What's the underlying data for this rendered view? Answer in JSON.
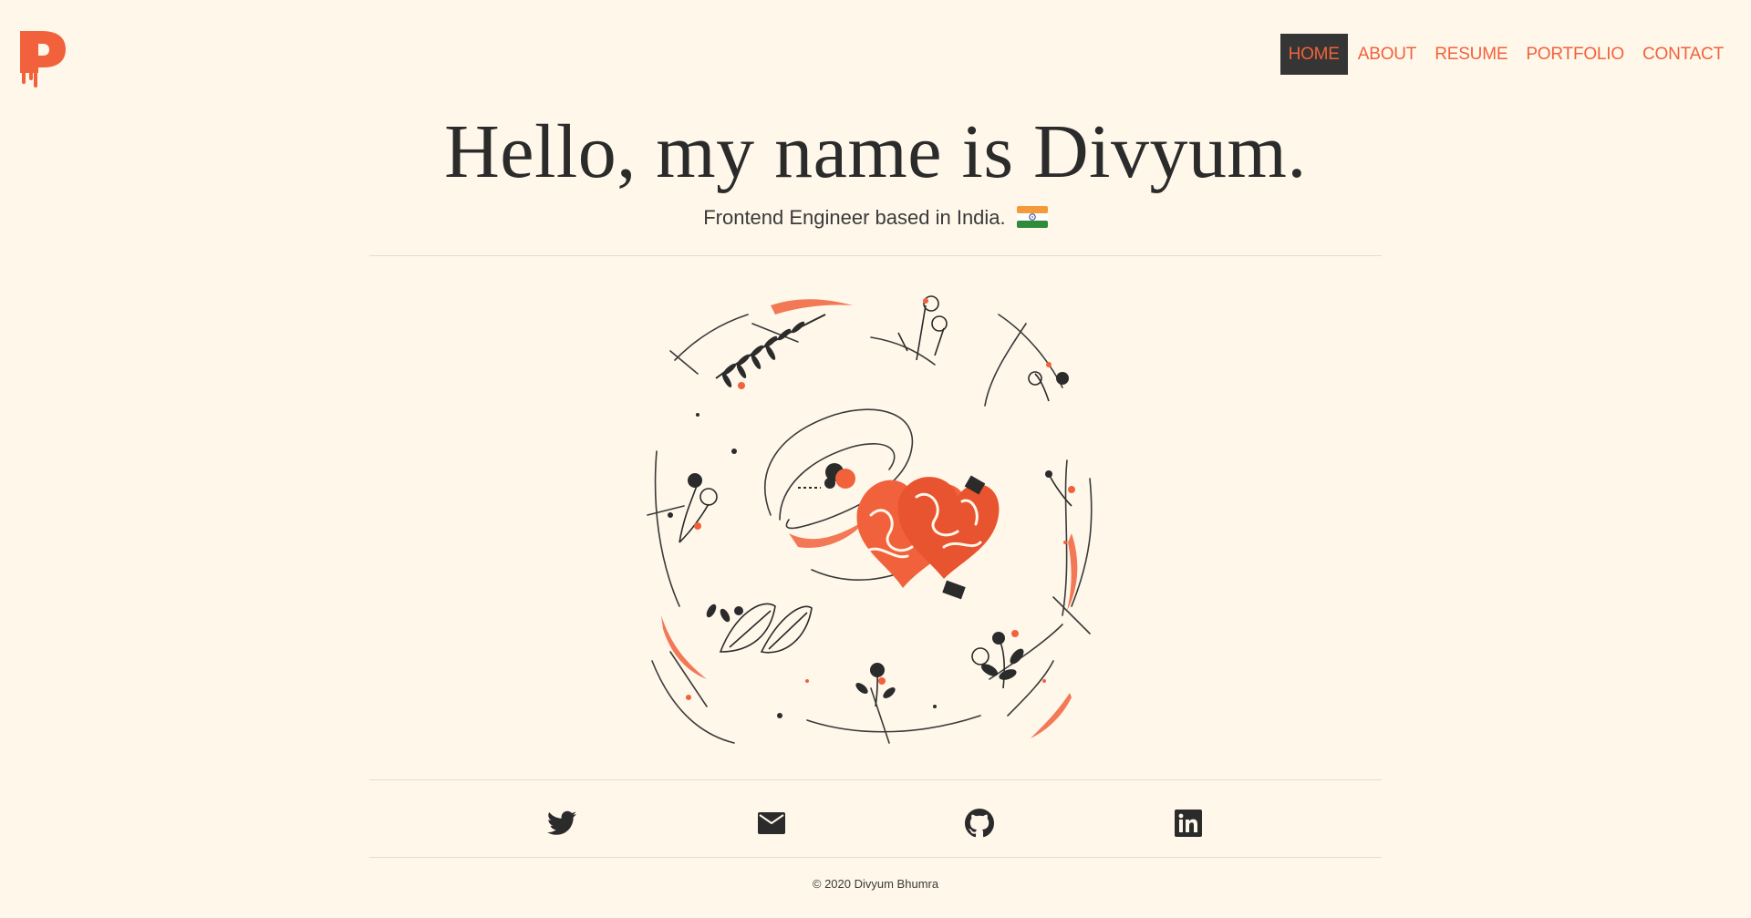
{
  "header": {
    "logo_icon": "drip-p-logo-icon",
    "brand_color": "#f1623c",
    "nav": [
      {
        "label": "HOME",
        "active": true
      },
      {
        "label": "ABOUT",
        "active": false
      },
      {
        "label": "RESUME",
        "active": false
      },
      {
        "label": "PORTFOLIO",
        "active": false
      },
      {
        "label": "CONTACT",
        "active": false
      }
    ]
  },
  "hero": {
    "title": "Hello, my name is Divyum.",
    "subtitle": "Frontend Engineer based in India.",
    "flag_icon": "india-flag-icon"
  },
  "illustration": {
    "icon": "floral-heart-illustration"
  },
  "socials": [
    {
      "icon": "twitter-icon"
    },
    {
      "icon": "mail-icon"
    },
    {
      "icon": "github-icon"
    },
    {
      "icon": "linkedin-icon"
    }
  ],
  "footer": {
    "copyright": "© 2020 Divyum Bhumra"
  },
  "colors": {
    "background": "#fff7ea",
    "accent": "#f1623c",
    "dark": "#2b2b2b"
  }
}
